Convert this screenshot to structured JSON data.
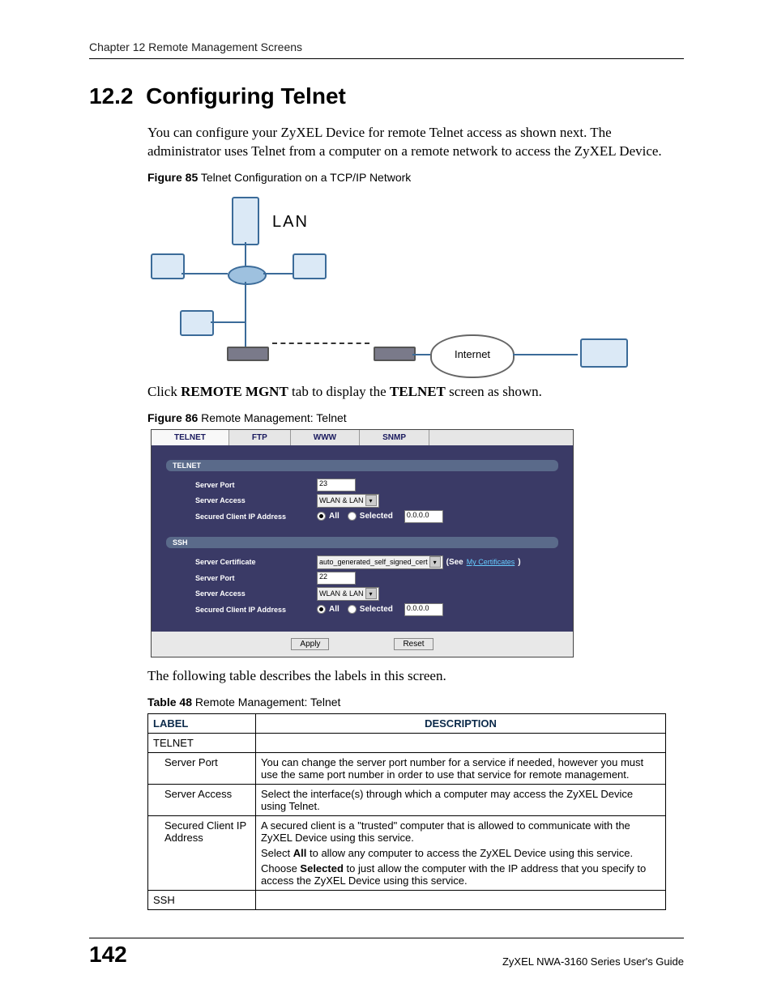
{
  "header": {
    "chapter": "Chapter 12 Remote Management Screens"
  },
  "section": {
    "number": "12.2",
    "title": "Configuring Telnet",
    "intro": "You can configure your ZyXEL Device for remote Telnet access as shown next. The administrator uses Telnet from a computer on a remote network to access the ZyXEL Device.",
    "click_text_parts": {
      "p1": "Click ",
      "b1": "REMOTE MGNT",
      "p2": " tab to display the ",
      "b2": "TELNET",
      "p3": " screen as shown."
    },
    "after_figure": "The following table describes the labels in this screen."
  },
  "figure85": {
    "caption_bold": "Figure 85",
    "caption_rest": "   Telnet Configuration on a TCP/IP Network",
    "lan_label": "LAN",
    "internet_label": "Internet"
  },
  "figure86": {
    "caption_bold": "Figure 86",
    "caption_rest": "   Remote Management: Telnet",
    "tabs": {
      "telnet": "TELNET",
      "ftp": "FTP",
      "www": "WWW",
      "snmp": "SNMP"
    },
    "telnet_section": "TELNET",
    "ssh_section": "SSH",
    "rows": {
      "server_port": "Server Port",
      "server_access": "Server Access",
      "secured_ip": "Secured Client IP Address",
      "server_cert": "Server Certificate"
    },
    "values": {
      "telnet_port": "23",
      "ssh_port": "22",
      "access_select": "WLAN & LAN",
      "cert_select": "auto_generated_self_signed_cert",
      "ip_value": "0.0.0.0",
      "radio_all": "All",
      "radio_selected": "Selected",
      "see_text": "(See ",
      "link_text": "My Certificates",
      "see_close": ")"
    },
    "buttons": {
      "apply": "Apply",
      "reset": "Reset"
    }
  },
  "table48": {
    "caption_bold": "Table 48",
    "caption_rest": "   Remote Management: Telnet",
    "head": {
      "label": "LABEL",
      "desc": "DESCRIPTION"
    },
    "rows": {
      "r1": {
        "label": "TELNET",
        "desc": ""
      },
      "r2": {
        "label": "Server Port",
        "desc": "You can change the server port number for a service if needed, however you must use the same port number in order to use that service for remote management."
      },
      "r3": {
        "label": "Server Access",
        "desc": "Select the interface(s) through which a computer may access the ZyXEL Device using Telnet."
      },
      "r4": {
        "label": "Secured Client IP Address",
        "desc_p1": "A secured client is a \"trusted\" computer that is allowed to communicate with the ZyXEL Device using this service.",
        "desc_p2a": "Select ",
        "desc_p2b": "All",
        "desc_p2c": " to allow any computer to access the ZyXEL Device using this service.",
        "desc_p3a": "Choose ",
        "desc_p3b": "Selected",
        "desc_p3c": " to just allow the computer with the IP address that you specify to access the ZyXEL Device using this service."
      },
      "r5": {
        "label": "SSH",
        "desc": ""
      }
    }
  },
  "footer": {
    "page_number": "142",
    "guide": "ZyXEL NWA-3160 Series User's Guide"
  }
}
